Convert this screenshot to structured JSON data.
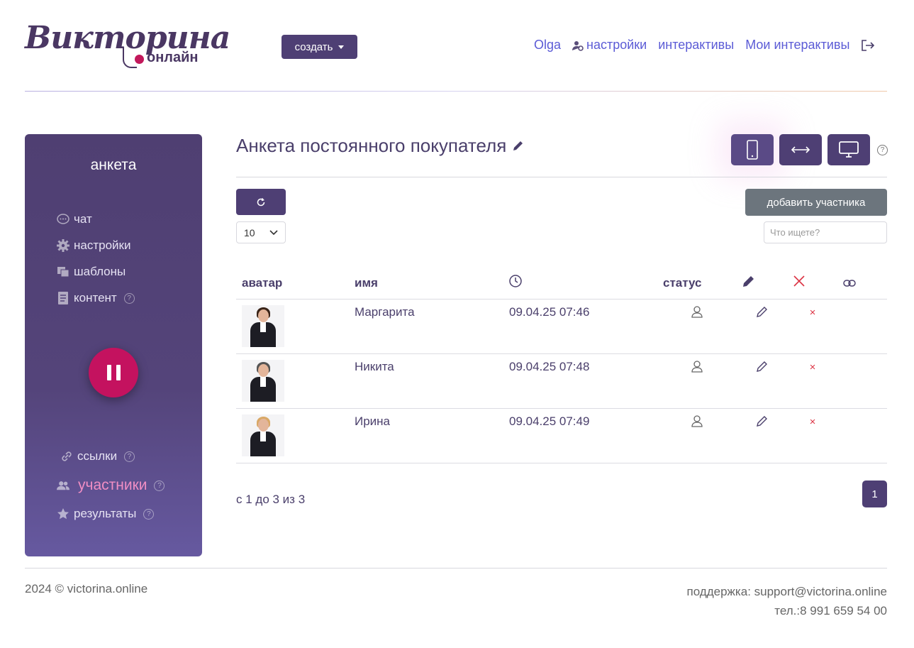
{
  "header": {
    "logo_word": "Викторина",
    "logo_sub": "онлайн",
    "create_label": "создать",
    "nav": {
      "user": "Olga",
      "settings": "настройки",
      "interactives": "интерактивы",
      "my_interactives": "Мои интерактивы"
    }
  },
  "sidebar": {
    "title": "анкета",
    "items": [
      {
        "label": "чат",
        "icon": "chat-icon"
      },
      {
        "label": "настройки",
        "icon": "gear-icon"
      },
      {
        "label": "шаблоны",
        "icon": "templates-icon"
      },
      {
        "label": "контент",
        "icon": "document-icon"
      }
    ],
    "bottom_items": [
      {
        "label": "ссылки",
        "icon": "link-icon"
      },
      {
        "label": "участники",
        "icon": "users-icon",
        "active": true
      },
      {
        "label": "результаты",
        "icon": "star-icon"
      }
    ],
    "help": "?"
  },
  "main": {
    "title": "Анкета постоянного покупателя",
    "add_participant": "добавить участника",
    "per_page": "10",
    "search_placeholder": "Что ищете?",
    "help": "?",
    "table": {
      "headers": {
        "avatar": "аватар",
        "name": "имя",
        "status": "статус"
      },
      "rows": [
        {
          "name": "Маргарита",
          "time": "09.04.25 07:46",
          "hair": "#3a2418"
        },
        {
          "name": "Никита",
          "time": "09.04.25 07:48",
          "hair": "#555"
        },
        {
          "name": "Ирина",
          "time": "09.04.25 07:49",
          "hair": "#d9a866"
        }
      ],
      "delete_glyph": "×"
    },
    "pager_info": "с 1 до 3 из 3",
    "page": "1"
  },
  "footer": {
    "copyright": "2024 © victorina.online",
    "support": "поддержка: support@victorina.online",
    "phone": "тел.:8 991 659 54 00"
  },
  "colors": {
    "primary": "#4e3f74",
    "accent": "#c4125f",
    "link": "#5b5bd6",
    "danger": "#dc3545"
  }
}
